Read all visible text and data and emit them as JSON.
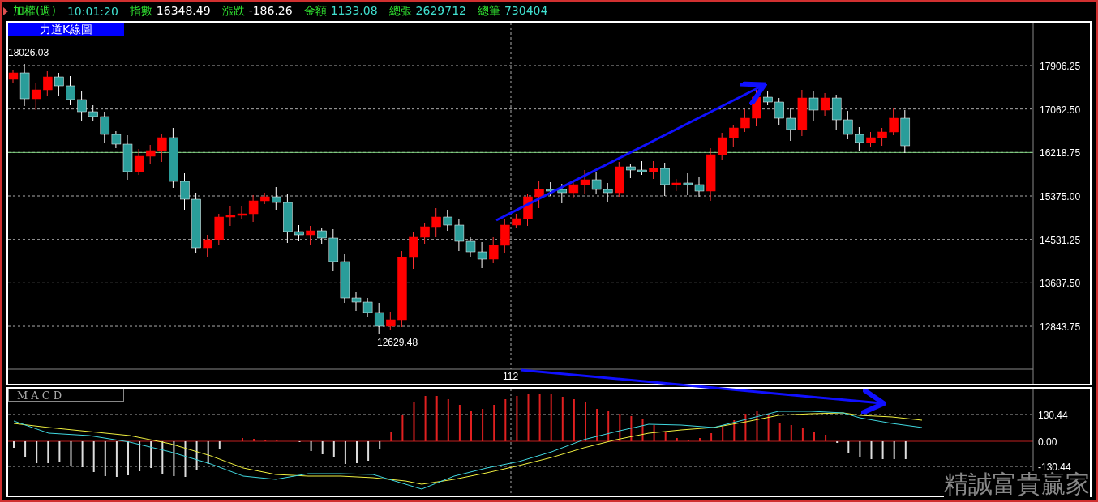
{
  "header": {
    "title": "加權(週)",
    "time": "10:01:20",
    "fields": [
      {
        "label": "指數",
        "value": "16348.49",
        "color": "#ffffff"
      },
      {
        "label": "漲跌",
        "value": "-186.26",
        "color": "#ffffff"
      },
      {
        "label": "金額",
        "value": "1133.08",
        "color": "#40e0d0"
      },
      {
        "label": "總張",
        "value": "2629712",
        "color": "#40e0d0"
      },
      {
        "label": "總筆",
        "value": "730404",
        "color": "#40e0d0"
      }
    ]
  },
  "price_chart": {
    "title": "力道K線圖",
    "axis_labels": [
      "17906.25",
      "17062.50",
      "16218.75",
      "15375.00",
      "14531.25",
      "13687.50",
      "12843.75"
    ],
    "high_label": "18026.03",
    "low_label": "12629.48",
    "cursor_label": "112"
  },
  "macd": {
    "title": "MACD",
    "axis_labels": [
      "130.44",
      "0.00",
      "-130.44"
    ]
  },
  "watermark": "精誠富貴贏家"
}
